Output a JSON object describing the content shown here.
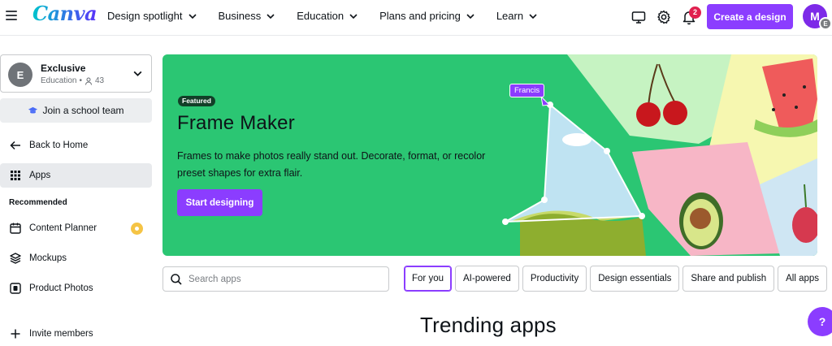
{
  "brand": {
    "logo_text": "Canva",
    "accent": "#8b3dff"
  },
  "header": {
    "nav": [
      {
        "label": "Design spotlight"
      },
      {
        "label": "Business"
      },
      {
        "label": "Education"
      },
      {
        "label": "Plans and pricing"
      },
      {
        "label": "Learn"
      }
    ],
    "notification_count": "2",
    "create_label": "Create a design",
    "avatar_initial": "M",
    "avatar_sub_initial": "E"
  },
  "sidebar": {
    "team": {
      "initial": "E",
      "name": "Exclusive",
      "type": "Education",
      "members": "43"
    },
    "join_label": "Join a school team",
    "back_label": "Back to Home",
    "apps_label": "Apps",
    "recommended_heading": "Recommended",
    "recommended": [
      {
        "label": "Content Planner",
        "icon": "calendar-icon"
      },
      {
        "label": "Mockups",
        "icon": "layers-icon"
      },
      {
        "label": "Product Photos",
        "icon": "product-photo-icon"
      }
    ],
    "invite_label": "Invite members"
  },
  "banner": {
    "featured_label": "Featured",
    "title": "Frame Maker",
    "description": "Frames to make photos really stand out. Decorate, format, or recolor preset shapes for extra flair.",
    "cta_label": "Start designing",
    "cursor_name": "Francis",
    "background_color": "#2bc673"
  },
  "apps": {
    "search_placeholder": "Search apps",
    "filters": [
      {
        "label": "For you",
        "active": true
      },
      {
        "label": "AI-powered"
      },
      {
        "label": "Productivity"
      },
      {
        "label": "Design essentials"
      },
      {
        "label": "Share and publish"
      },
      {
        "label": "All apps"
      }
    ],
    "section_title": "Trending apps"
  },
  "help_label": "?"
}
